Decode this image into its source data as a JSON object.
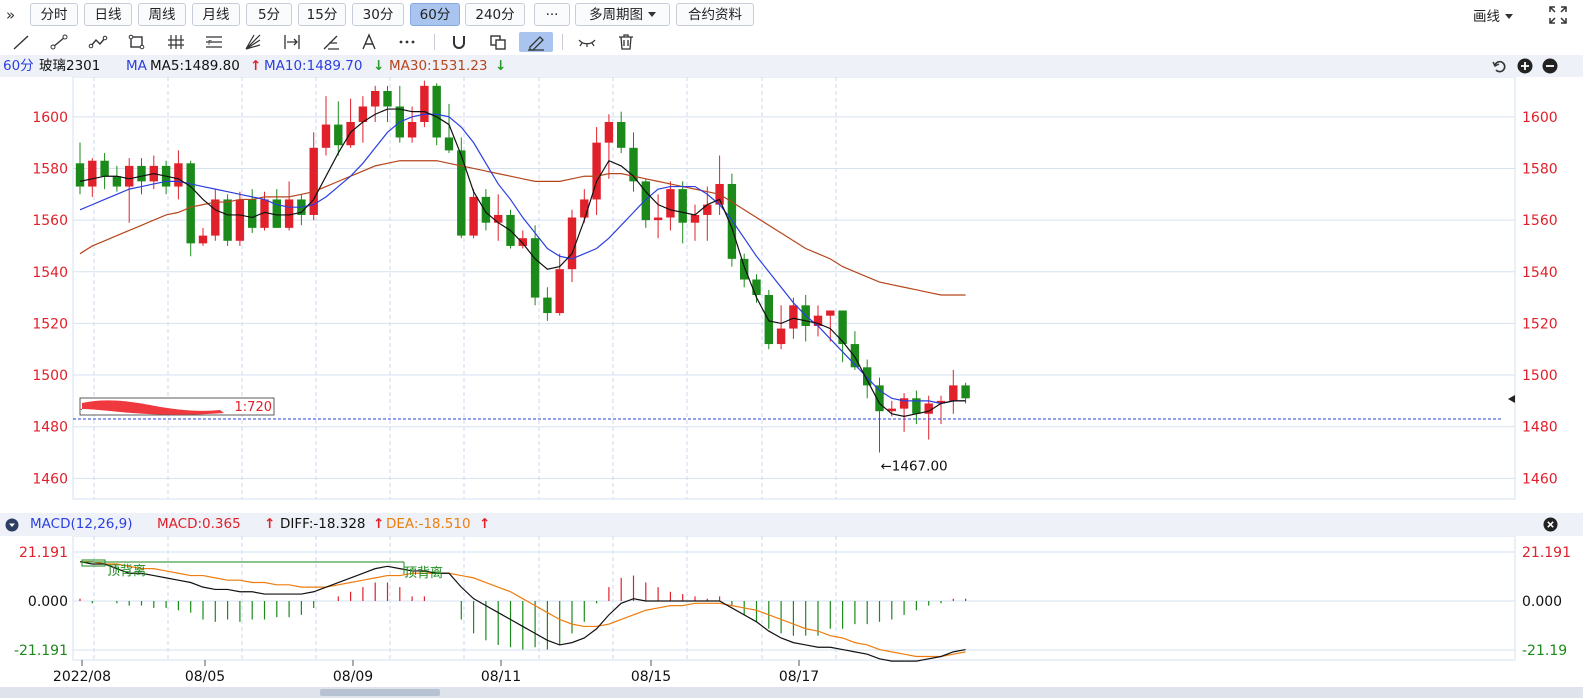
{
  "toolbar": {
    "periods": [
      {
        "label": "分时",
        "active": false
      },
      {
        "label": "日线",
        "active": false
      },
      {
        "label": "周线",
        "active": false
      },
      {
        "label": "月线",
        "active": false
      },
      {
        "label": "5分",
        "active": false
      },
      {
        "label": "15分",
        "active": false
      },
      {
        "label": "30分",
        "active": false
      },
      {
        "label": "60分",
        "active": true
      },
      {
        "label": "240分",
        "active": false
      }
    ],
    "more_label": "···",
    "multi_period_label": "多周期图",
    "contract_info_label": "合约资料",
    "draw_menu_label": "画线"
  },
  "indicator": {
    "period": "60分",
    "symbol": "玻璃2301",
    "ma_label": "MA",
    "ma5": "MA5:1489.80",
    "ma10": "MA10:1489.70",
    "ma30": "MA30:1531.23",
    "ma5_trend": "up",
    "ma10_trend": "down",
    "ma30_trend": "down"
  },
  "macd_header": {
    "name": "MACD(12,26,9)",
    "macd": "MACD:0.365",
    "diff": "DIFF:-18.328",
    "dea": "DEA:-18.510"
  },
  "colors": {
    "up": "#e0202a",
    "down": "#1b8a1b",
    "ma5": "#111111",
    "ma10": "#2b3fe0",
    "ma30": "#b5461c",
    "dea": "#ee7d0f",
    "grid": "#d6e2f0",
    "axis": "#e0202a"
  },
  "chart_data": [
    {
      "type": "candlestick",
      "title": "",
      "y_ticks": [
        1600,
        1580,
        1560,
        1540,
        1520,
        1500,
        1480,
        1460
      ],
      "ylim": [
        1452,
        1610
      ],
      "last_price_line": 1483,
      "min_annotation": {
        "label": "←1467.00",
        "value": 1467.0
      },
      "position_label_fragment": "1:720",
      "candles": [
        [
          1582,
          1573,
          1590,
          1570
        ],
        [
          1573,
          1583,
          1584,
          1569
        ],
        [
          1583,
          1577,
          1586,
          1572
        ],
        [
          1577,
          1573,
          1581,
          1571
        ],
        [
          1573,
          1581,
          1584,
          1559
        ],
        [
          1581,
          1575,
          1584,
          1570
        ],
        [
          1575,
          1581,
          1585,
          1572
        ],
        [
          1581,
          1573,
          1583,
          1570
        ],
        [
          1573,
          1582,
          1587,
          1568
        ],
        [
          1582,
          1551,
          1583,
          1546
        ],
        [
          1551,
          1554,
          1557,
          1550
        ],
        [
          1554,
          1568,
          1572,
          1552
        ],
        [
          1568,
          1552,
          1570,
          1550
        ],
        [
          1552,
          1568,
          1571,
          1550
        ],
        [
          1568,
          1557,
          1572,
          1555
        ],
        [
          1557,
          1568,
          1571,
          1556
        ],
        [
          1568,
          1557,
          1572,
          1557
        ],
        [
          1557,
          1568,
          1575,
          1556
        ],
        [
          1568,
          1562,
          1570,
          1558
        ],
        [
          1562,
          1588,
          1594,
          1560
        ],
        [
          1588,
          1597,
          1608,
          1585
        ],
        [
          1597,
          1589,
          1606,
          1585
        ],
        [
          1589,
          1598,
          1607,
          1588
        ],
        [
          1598,
          1604,
          1608,
          1590
        ],
        [
          1604,
          1610,
          1612,
          1598
        ],
        [
          1610,
          1604,
          1612,
          1598
        ],
        [
          1604,
          1592,
          1612,
          1590
        ],
        [
          1592,
          1598,
          1604,
          1590
        ],
        [
          1598,
          1612,
          1614,
          1596
        ],
        [
          1612,
          1592,
          1613,
          1589
        ],
        [
          1592,
          1587,
          1605,
          1586
        ],
        [
          1587,
          1554,
          1592,
          1553
        ],
        [
          1554,
          1569,
          1572,
          1553
        ],
        [
          1569,
          1559,
          1572,
          1556
        ],
        [
          1559,
          1562,
          1570,
          1552
        ],
        [
          1562,
          1550,
          1564,
          1549
        ],
        [
          1550,
          1553,
          1556,
          1549
        ],
        [
          1553,
          1530,
          1558,
          1527
        ],
        [
          1530,
          1524,
          1534,
          1521
        ],
        [
          1524,
          1541,
          1547,
          1523
        ],
        [
          1541,
          1561,
          1564,
          1536
        ],
        [
          1561,
          1568,
          1572,
          1559
        ],
        [
          1568,
          1590,
          1596,
          1562
        ],
        [
          1590,
          1598,
          1601,
          1576
        ],
        [
          1598,
          1588,
          1602,
          1586
        ],
        [
          1588,
          1575,
          1594,
          1571
        ],
        [
          1575,
          1560,
          1576,
          1557
        ],
        [
          1560,
          1561,
          1570,
          1553
        ],
        [
          1561,
          1572,
          1575,
          1556
        ],
        [
          1572,
          1559,
          1575,
          1551
        ],
        [
          1559,
          1562,
          1566,
          1552
        ],
        [
          1562,
          1566,
          1573,
          1552
        ],
        [
          1566,
          1574,
          1585,
          1562
        ],
        [
          1574,
          1545,
          1578,
          1542
        ],
        [
          1545,
          1537,
          1547,
          1534
        ],
        [
          1537,
          1531,
          1539,
          1528
        ],
        [
          1531,
          1512,
          1533,
          1510
        ],
        [
          1512,
          1518,
          1527,
          1510
        ],
        [
          1518,
          1527,
          1530,
          1514
        ],
        [
          1527,
          1519,
          1531,
          1513
        ],
        [
          1519,
          1523,
          1527,
          1515
        ],
        [
          1523,
          1525,
          1525,
          1513
        ],
        [
          1525,
          1512,
          1522,
          1505
        ],
        [
          1512,
          1503,
          1517,
          1502
        ],
        [
          1503,
          1496,
          1506,
          1491
        ],
        [
          1496,
          1486,
          1499,
          1470
        ],
        [
          1486,
          1487,
          1490,
          1484
        ],
        [
          1487,
          1491,
          1493,
          1478
        ],
        [
          1491,
          1485,
          1494,
          1481
        ],
        [
          1485,
          1489,
          1492,
          1475
        ],
        [
          1489,
          1490,
          1492,
          1481
        ],
        [
          1490,
          1496,
          1502,
          1485
        ],
        [
          1496,
          1491,
          1497,
          1489
        ]
      ],
      "ma5": [
        1575,
        1576,
        1577,
        1577,
        1576,
        1577,
        1578,
        1577,
        1576,
        1573,
        1568,
        1564,
        1562,
        1562,
        1561,
        1563,
        1562,
        1562,
        1563,
        1568,
        1577,
        1586,
        1594,
        1598,
        1601,
        1603,
        1603,
        1602,
        1602,
        1600,
        1597,
        1585,
        1571,
        1563,
        1559,
        1556,
        1551,
        1545,
        1541,
        1542,
        1547,
        1560,
        1575,
        1583,
        1581,
        1577,
        1571,
        1566,
        1564,
        1563,
        1562,
        1566,
        1568,
        1557,
        1542,
        1530,
        1521,
        1520,
        1522,
        1521,
        1520,
        1518,
        1513,
        1507,
        1498,
        1489,
        1485,
        1484,
        1485,
        1486,
        1489,
        1490,
        1490
      ],
      "ma10": [
        1564,
        1566,
        1568,
        1570,
        1572,
        1573,
        1574,
        1575,
        1575,
        1574,
        1573,
        1572,
        1571,
        1570,
        1569,
        1568,
        1566,
        1565,
        1565,
        1566,
        1569,
        1573,
        1577,
        1582,
        1588,
        1594,
        1598,
        1600,
        1601,
        1601,
        1600,
        1596,
        1590,
        1582,
        1574,
        1568,
        1561,
        1555,
        1549,
        1546,
        1545,
        1547,
        1549,
        1553,
        1558,
        1563,
        1568,
        1572,
        1573,
        1573,
        1573,
        1570,
        1566,
        1560,
        1553,
        1546,
        1540,
        1534,
        1528,
        1523,
        1519,
        1514,
        1509,
        1504,
        1499,
        1494,
        1491,
        1490,
        1490,
        1490,
        1489,
        1490,
        1490
      ],
      "ma30": [
        1547,
        1550,
        1552,
        1554,
        1556,
        1558,
        1560,
        1562,
        1563,
        1565,
        1566,
        1567,
        1567,
        1568,
        1568,
        1569,
        1569,
        1569,
        1570,
        1571,
        1573,
        1575,
        1577,
        1579,
        1581,
        1582,
        1583,
        1583,
        1583,
        1583,
        1582,
        1581,
        1580,
        1579,
        1578,
        1577,
        1576,
        1575,
        1575,
        1575,
        1576,
        1577,
        1577,
        1578,
        1578,
        1577,
        1576,
        1575,
        1574,
        1573,
        1572,
        1571,
        1570,
        1567,
        1564,
        1561,
        1558,
        1555,
        1552,
        1549,
        1547,
        1545,
        1542,
        1540,
        1538,
        1536,
        1535,
        1534,
        1533,
        1532,
        1531,
        1531,
        1531
      ]
    },
    {
      "type": "macd",
      "title": "",
      "y_ticks": [
        21.191,
        0.0,
        -21.191
      ],
      "y_tick_labels": [
        "21.191",
        "0.000",
        "-21.191"
      ],
      "right_tick_labels": [
        "21.191",
        "0.000",
        "-21.19"
      ],
      "x_labels": [
        "2022/08",
        "08/05",
        "08/09",
        "08/11",
        "08/15",
        "08/17"
      ],
      "divergence_labels": [
        "顶背离",
        "顶背离"
      ],
      "diff": [
        17,
        16,
        16,
        14,
        12,
        12,
        11,
        10,
        9,
        8,
        6,
        5,
        5,
        4,
        4,
        3,
        3,
        3,
        3,
        4,
        6,
        8,
        10,
        12,
        14,
        15,
        14,
        13,
        13,
        12,
        12,
        6,
        1,
        -2,
        -5,
        -8,
        -11,
        -14,
        -17,
        -19,
        -18,
        -16,
        -12,
        -6,
        -1,
        1,
        0,
        0,
        0,
        0,
        0,
        0,
        0,
        -3,
        -6,
        -9,
        -13,
        -16,
        -18,
        -19,
        -20,
        -20,
        -21,
        -22,
        -23,
        -25,
        -26,
        -26,
        -26,
        -25,
        -24,
        -22,
        -21
      ],
      "dea": [
        17,
        17,
        16,
        16,
        15,
        14,
        14,
        13,
        12,
        11,
        11,
        10,
        9,
        9,
        8,
        8,
        7,
        7,
        6,
        6,
        6,
        7,
        8,
        9,
        10,
        11,
        11,
        12,
        12,
        12,
        12,
        11,
        10,
        8,
        6,
        4,
        1,
        -2,
        -5,
        -8,
        -10,
        -11,
        -11,
        -10,
        -8,
        -6,
        -4,
        -3,
        -2,
        -2,
        -1,
        -1,
        -1,
        -2,
        -3,
        -4,
        -6,
        -8,
        -10,
        -12,
        -13,
        -15,
        -16,
        -18,
        -19,
        -21,
        -22,
        -23,
        -24,
        -24,
        -24,
        -23,
        -22
      ],
      "macd": [
        1,
        -1,
        0,
        -1,
        -2,
        -2,
        -3,
        -3,
        -4,
        -5,
        -8,
        -9,
        -8,
        -9,
        -8,
        -8,
        -7,
        -7,
        -6,
        -3,
        0,
        2,
        4,
        6,
        8,
        8,
        6,
        2,
        2,
        0,
        0,
        -8,
        -14,
        -17,
        -19,
        -20,
        -21,
        -20,
        -21,
        -19,
        -14,
        -9,
        -1,
        6,
        10,
        11,
        8,
        6,
        4,
        3,
        2,
        1,
        2,
        -2,
        -6,
        -9,
        -12,
        -14,
        -15,
        -15,
        -15,
        -12,
        -12,
        -10,
        -10,
        -9,
        -8,
        -6,
        -4,
        -2,
        -1,
        1,
        1
      ]
    }
  ]
}
